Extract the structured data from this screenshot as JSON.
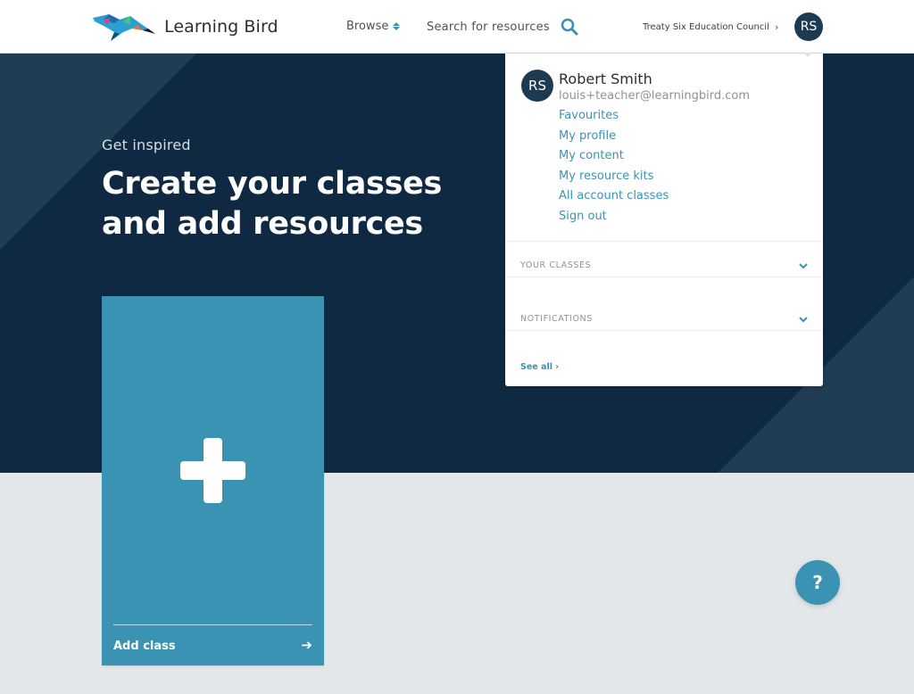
{
  "header": {
    "brand": "Learning Bird",
    "browse_label": "Browse",
    "search_placeholder": "Search for resources",
    "organization": "Treaty Six Education Council",
    "user_initials": "RS"
  },
  "hero": {
    "eyebrow": "Get inspired",
    "title_line1": "Create your classes",
    "title_line2": "and add resources"
  },
  "add_class_card": {
    "label": "Add class"
  },
  "help_button": {
    "label": "?"
  },
  "user_menu": {
    "initials": "RS",
    "name": "Robert Smith",
    "email": "louis+teacher@learningbird.com",
    "items": [
      {
        "label": "Favourites"
      },
      {
        "label": "My profile"
      },
      {
        "label": "My content"
      },
      {
        "label": "My resource kits"
      },
      {
        "label": "All account classes"
      },
      {
        "label": "Sign out"
      }
    ],
    "sections": [
      {
        "label": "YOUR CLASSES"
      },
      {
        "label": "NOTIFICATIONS"
      }
    ],
    "see_all": "See all"
  },
  "colors": {
    "accent": "#3a93b3",
    "hero_bg": "#0f2942",
    "avatar_bg": "#1d3a53",
    "page_bg": "#e4e7e9"
  }
}
